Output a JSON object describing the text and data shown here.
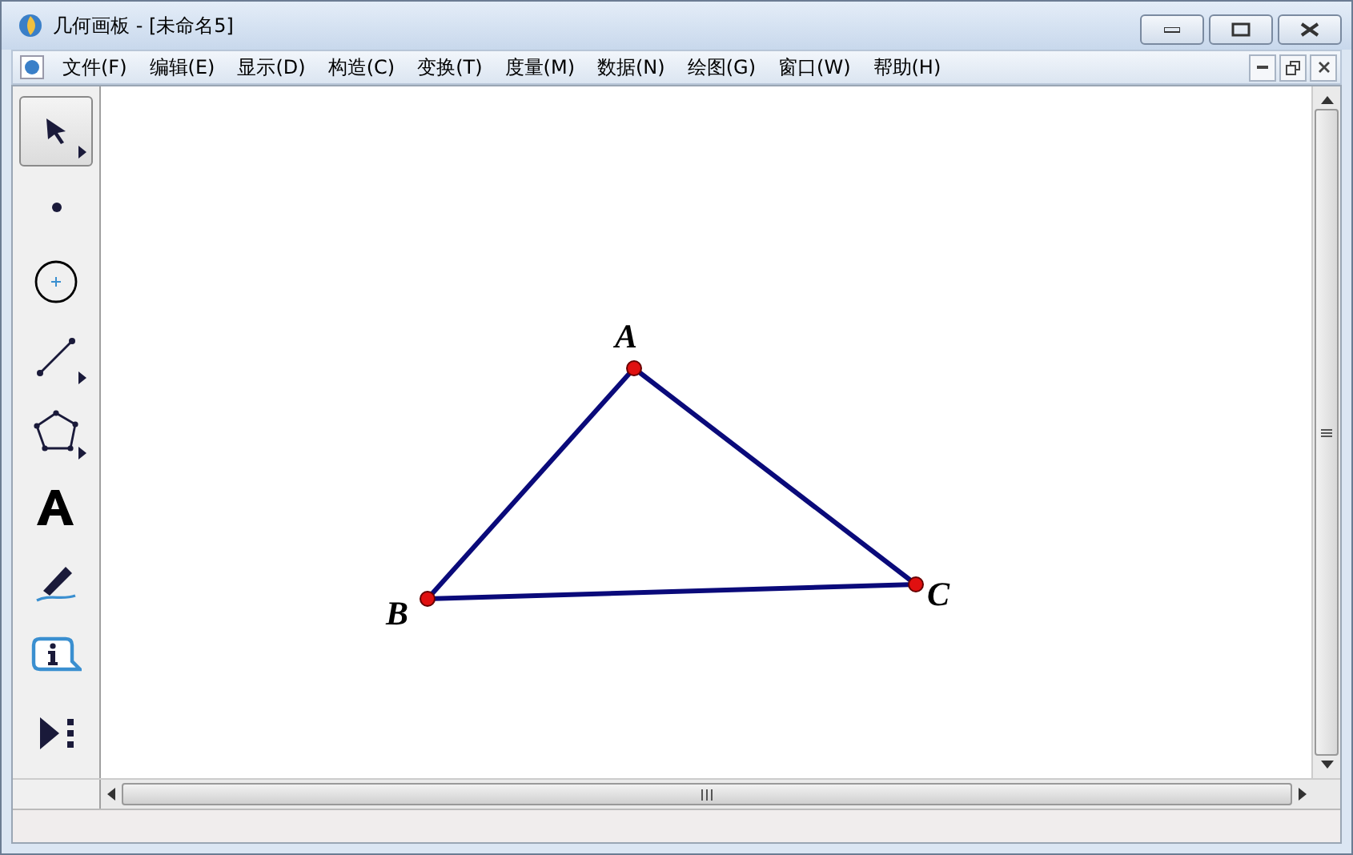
{
  "window": {
    "title": "几何画板 - [未命名5]"
  },
  "menu": [
    "文件(F)",
    "编辑(E)",
    "显示(D)",
    "构造(C)",
    "变换(T)",
    "度量(M)",
    "数据(N)",
    "绘图(G)",
    "窗口(W)",
    "帮助(H)"
  ],
  "tools": [
    {
      "kind": "arrow",
      "selected": true,
      "submenu": true
    },
    {
      "kind": "point",
      "selected": false,
      "submenu": false
    },
    {
      "kind": "compass",
      "selected": false,
      "submenu": false
    },
    {
      "kind": "segment",
      "selected": false,
      "submenu": true
    },
    {
      "kind": "polygon",
      "selected": false,
      "submenu": true
    },
    {
      "kind": "text",
      "selected": false,
      "submenu": false
    },
    {
      "kind": "marker",
      "selected": false,
      "submenu": false
    },
    {
      "kind": "info",
      "selected": false,
      "submenu": false
    },
    {
      "kind": "custom",
      "selected": false,
      "submenu": false
    }
  ],
  "canvas": {
    "points": [
      {
        "label": "A"
      },
      {
        "label": "B"
      },
      {
        "label": "C"
      }
    ]
  }
}
